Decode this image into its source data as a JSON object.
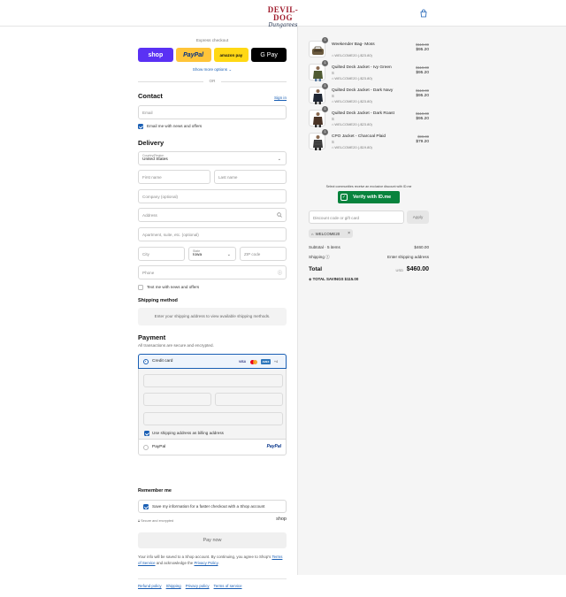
{
  "header": {
    "brand_line1": "DEVIL-DOG",
    "brand_line2": "Dungarees"
  },
  "express": {
    "label": "Express checkout",
    "shop_label": "shop",
    "paypal_label": "PayPal",
    "amazon_label": "amazon pay",
    "gpay_label": "G Pay",
    "show_more": "Show more options ⌄",
    "or_label": "OR"
  },
  "contact": {
    "title": "Contact",
    "signin": "Sign in",
    "email_placeholder": "Email",
    "news_label": "Email me with news and offers",
    "news_checked": true
  },
  "delivery": {
    "title": "Delivery",
    "country_label": "Country/Region",
    "country_value": "United States",
    "first_name": "First name",
    "last_name": "Last name",
    "company": "Company (optional)",
    "address": "Address",
    "apartment": "Apartment, suite, etc. (optional)",
    "city": "City",
    "state_label": "State",
    "state_value": "Iowa",
    "zip": "ZIP code",
    "phone": "Phone",
    "text_label": "Text me with news and offers",
    "text_checked": false
  },
  "shipping": {
    "title": "Shipping method",
    "message": "Enter your shipping address to view available shipping methods."
  },
  "payment": {
    "title": "Payment",
    "subtitle": "All transactions are secure and encrypted.",
    "credit_card": "Credit card",
    "card_visa": "VISA",
    "card_amex": "AMEX",
    "card_more": "+4",
    "billing_label": "Use shipping address as billing address",
    "billing_checked": true,
    "paypal": "PayPal",
    "paypal_logo": "PayPal"
  },
  "remember": {
    "title": "Remember me",
    "save_label": "Save my information for a faster checkout with a Shop account",
    "save_checked": true,
    "secure": "Secure and encrypted",
    "shop_word": "shop"
  },
  "pay_now": "Pay now",
  "legal": {
    "text1": "Your info will be saved to a Shop account. By continuing, you agree to Shop's",
    "terms": "Terms of Service",
    "text2": " and acknowledge the ",
    "privacy": "Privacy Policy",
    "text3": "."
  },
  "footer": {
    "links": [
      "Refund policy",
      "Shipping",
      "Privacy policy",
      "Terms of service"
    ]
  },
  "cart": {
    "items": [
      {
        "qty": "1",
        "name": "Weekender Bag- Moss",
        "size": "",
        "discount": "WELCOME20 (-$23.80)",
        "old_price": "$119.00",
        "price": "$95.20"
      },
      {
        "qty": "1",
        "name": "Quilted Deck Jacket - Ivy Green",
        "size": "S",
        "discount": "WELCOME20 (-$23.80)",
        "old_price": "$119.00",
        "price": "$95.20"
      },
      {
        "qty": "1",
        "name": "Quilted Deck Jacket - Dark Navy",
        "size": "S",
        "discount": "WELCOME20 (-$23.80)",
        "old_price": "$119.00",
        "price": "$95.20"
      },
      {
        "qty": "1",
        "name": "Quilted Deck Jacket - Dark Roast",
        "size": "S",
        "discount": "WELCOME20 (-$23.80)",
        "old_price": "$119.00",
        "price": "$95.20"
      },
      {
        "qty": "1",
        "name": "CPO Jacket - Charcoal Plaid",
        "size": "S",
        "discount": "WELCOME20 (-$19.80)",
        "old_price": "$99.00",
        "price": "$79.20"
      }
    ],
    "idme_note": "Select communities receive an exclusive discount with ID.me",
    "idme_button": "Verify with ID.me",
    "discount_placeholder": "Discount code or gift card",
    "apply": "Apply",
    "chip_code": "WELCOME20",
    "subtotal_label": "Subtotal · 5 items",
    "subtotal_value": "$460.00",
    "shipping_label": "Shipping ⓘ",
    "shipping_value": "Enter shipping address",
    "total_label": "Total",
    "total_currency": "USD",
    "total_value": "$460.00",
    "savings": "TOTAL SAVINGS  $115.00"
  },
  "colors": {
    "accent": "#1a5fb4",
    "shop_purple": "#5a31f4",
    "paypal_yellow": "#ffc439",
    "idme_green": "#08833d",
    "brand_red": "#a01d2d"
  }
}
